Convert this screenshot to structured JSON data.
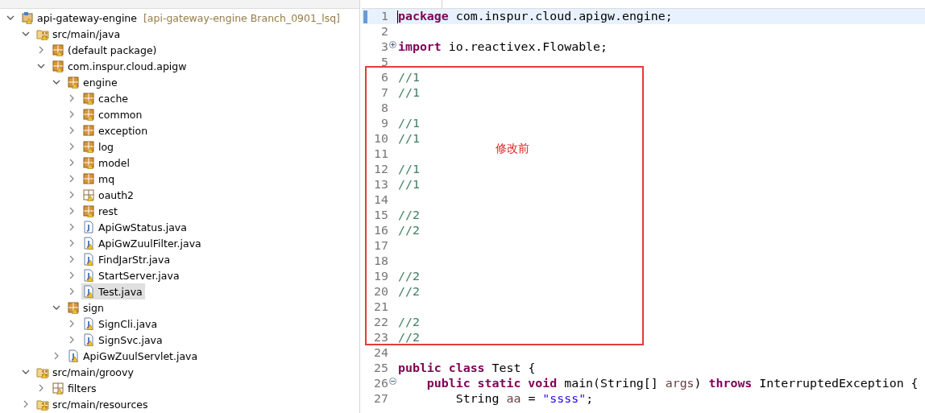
{
  "package_explorer": {
    "tree": [
      {
        "label": "api-gateway-engine",
        "decoration": "[api-gateway-engine Branch_0901_lsq]",
        "kind": "project",
        "warning": true,
        "expanded": true,
        "selected": false,
        "children": [
          {
            "label": "src/main/java",
            "kind": "srcfolder",
            "warning": true,
            "expanded": true,
            "selected": false,
            "children": [
              {
                "label": "(default package)",
                "kind": "package",
                "warning": true,
                "expanded": false,
                "selected": false
              },
              {
                "label": "com.inspur.cloud.apigw",
                "kind": "package",
                "warning": true,
                "expanded": true,
                "selected": false,
                "children": [
                  {
                    "label": "engine",
                    "kind": "package",
                    "warning": true,
                    "expanded": true,
                    "selected": false,
                    "children": [
                      {
                        "label": "cache",
                        "kind": "package",
                        "warning": true,
                        "expanded": false,
                        "selected": false
                      },
                      {
                        "label": "common",
                        "kind": "package",
                        "warning": true,
                        "expanded": false,
                        "selected": false
                      },
                      {
                        "label": "exception",
                        "kind": "package",
                        "warning": false,
                        "expanded": false,
                        "selected": false
                      },
                      {
                        "label": "log",
                        "kind": "package",
                        "warning": true,
                        "expanded": false,
                        "selected": false
                      },
                      {
                        "label": "model",
                        "kind": "package",
                        "warning": true,
                        "expanded": false,
                        "selected": false
                      },
                      {
                        "label": "mq",
                        "kind": "package",
                        "warning": false,
                        "expanded": false,
                        "selected": false
                      },
                      {
                        "label": "oauth2",
                        "kind": "emptypackage",
                        "warning": true,
                        "expanded": false,
                        "selected": false
                      },
                      {
                        "label": "rest",
                        "kind": "package",
                        "warning": true,
                        "expanded": false,
                        "selected": false
                      },
                      {
                        "label": "ApiGwStatus.java",
                        "kind": "java",
                        "warning": false,
                        "expanded": false,
                        "selected": false
                      },
                      {
                        "label": "ApiGwZuulFilter.java",
                        "kind": "java",
                        "warning": true,
                        "expanded": false,
                        "selected": false
                      },
                      {
                        "label": "FindJarStr.java",
                        "kind": "java",
                        "warning": true,
                        "expanded": false,
                        "selected": false
                      },
                      {
                        "label": "StartServer.java",
                        "kind": "java",
                        "warning": true,
                        "expanded": false,
                        "selected": false
                      },
                      {
                        "label": "Test.java",
                        "kind": "java",
                        "warning": true,
                        "expanded": false,
                        "selected": true
                      }
                    ]
                  },
                  {
                    "label": "sign",
                    "kind": "package",
                    "warning": true,
                    "expanded": true,
                    "selected": false,
                    "children": [
                      {
                        "label": "SignCli.java",
                        "kind": "java",
                        "warning": true,
                        "expanded": false,
                        "selected": false
                      },
                      {
                        "label": "SignSvc.java",
                        "kind": "java",
                        "warning": true,
                        "expanded": false,
                        "selected": false
                      }
                    ]
                  },
                  {
                    "label": "ApiGwZuulServlet.java",
                    "kind": "java",
                    "warning": true,
                    "expanded": false,
                    "selected": false
                  }
                ]
              }
            ]
          },
          {
            "label": "src/main/groovy",
            "kind": "srcfolder",
            "warning": true,
            "expanded": true,
            "selected": false,
            "children": [
              {
                "label": "filters",
                "kind": "emptypackage",
                "warning": true,
                "expanded": false,
                "selected": false
              }
            ]
          },
          {
            "label": "src/main/resources",
            "kind": "srcfolder",
            "warning": true,
            "expanded": false,
            "selected": false
          }
        ]
      }
    ]
  },
  "editor": {
    "lines": [
      {
        "number": "1",
        "current": true,
        "segments": [
          {
            "kind": "keyword",
            "text": "package"
          },
          {
            "kind": "plain",
            "text": " com.inspur.cloud.apigw.engine;"
          }
        ]
      },
      {
        "number": "2",
        "current": false
      },
      {
        "number": "3",
        "current": false,
        "folded": true,
        "segments": [
          {
            "kind": "keyword",
            "text": "import"
          },
          {
            "kind": "plain",
            "text": " io.reactivex.Flowable;"
          }
        ]
      },
      {
        "number": "5",
        "current": false
      },
      {
        "number": "6",
        "current": false,
        "segments": [
          {
            "kind": "comment",
            "text": "//1"
          }
        ]
      },
      {
        "number": "7",
        "current": false,
        "segments": [
          {
            "kind": "comment",
            "text": "//1"
          }
        ]
      },
      {
        "number": "8",
        "current": false
      },
      {
        "number": "9",
        "current": false,
        "segments": [
          {
            "kind": "comment",
            "text": "//1"
          }
        ]
      },
      {
        "number": "10",
        "current": false,
        "segments": [
          {
            "kind": "comment",
            "text": "//1"
          }
        ]
      },
      {
        "number": "11",
        "current": false
      },
      {
        "number": "12",
        "current": false,
        "segments": [
          {
            "kind": "comment",
            "text": "//1"
          }
        ]
      },
      {
        "number": "13",
        "current": false,
        "segments": [
          {
            "kind": "comment",
            "text": "//1"
          }
        ]
      },
      {
        "number": "14",
        "current": false
      },
      {
        "number": "15",
        "current": false,
        "segments": [
          {
            "kind": "comment",
            "text": "//2"
          }
        ]
      },
      {
        "number": "16",
        "current": false,
        "segments": [
          {
            "kind": "comment",
            "text": "//2"
          }
        ]
      },
      {
        "number": "17",
        "current": false
      },
      {
        "number": "18",
        "current": false
      },
      {
        "number": "19",
        "current": false,
        "segments": [
          {
            "kind": "comment",
            "text": "//2"
          }
        ]
      },
      {
        "number": "20",
        "current": false,
        "segments": [
          {
            "kind": "comment",
            "text": "//2"
          }
        ]
      },
      {
        "number": "21",
        "current": false
      },
      {
        "number": "22",
        "current": false,
        "segments": [
          {
            "kind": "comment",
            "text": "//2"
          }
        ]
      },
      {
        "number": "23",
        "current": false,
        "segments": [
          {
            "kind": "comment",
            "text": "//2"
          }
        ]
      },
      {
        "number": "24",
        "current": false
      },
      {
        "number": "25",
        "current": false,
        "segments": [
          {
            "kind": "keyword",
            "text": "public class"
          },
          {
            "kind": "plain",
            "text": " Test {"
          }
        ]
      },
      {
        "number": "26",
        "current": false,
        "folded": false,
        "segments": [
          {
            "kind": "keyword",
            "text": "    public static void"
          },
          {
            "kind": "plain",
            "text": " main(String[] "
          },
          {
            "kind": "variable",
            "text": "args"
          },
          {
            "kind": "plain",
            "text": ") "
          },
          {
            "kind": "keyword",
            "text": "throws"
          },
          {
            "kind": "plain",
            "text": " InterruptedException {"
          }
        ]
      },
      {
        "number": "27",
        "current": false,
        "segments": [
          {
            "kind": "plain",
            "text": "        String "
          },
          {
            "kind": "variable",
            "text": "aa"
          },
          {
            "kind": "plain",
            "text": " = "
          },
          {
            "kind": "string",
            "text": "\"ssss\""
          },
          {
            "kind": "plain",
            "text": ";"
          }
        ]
      }
    ],
    "annotation": {
      "text": "修改前"
    }
  }
}
